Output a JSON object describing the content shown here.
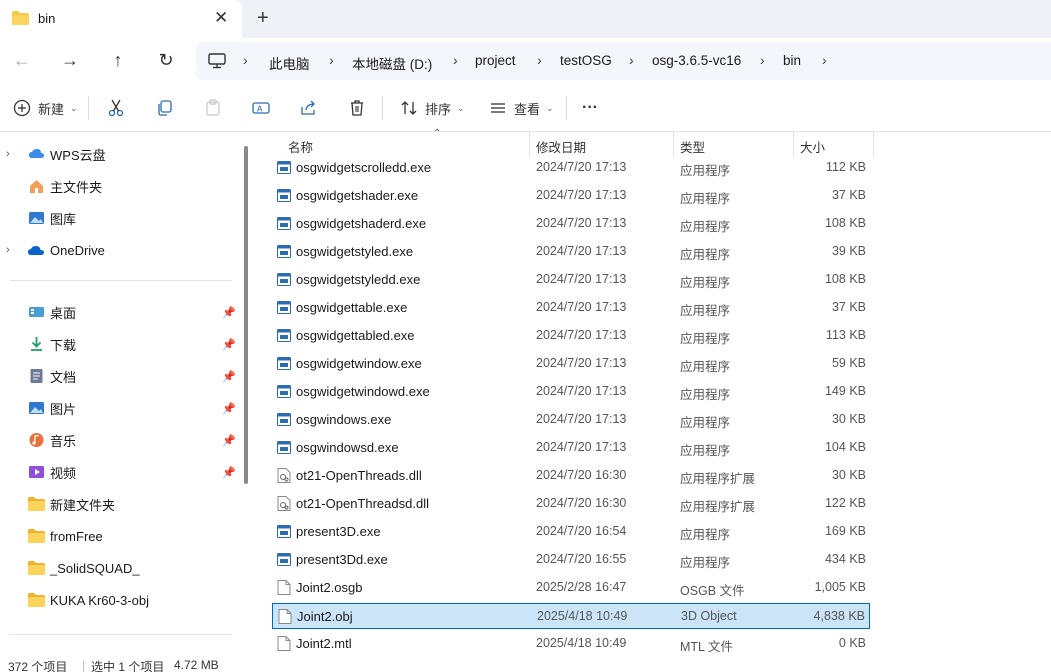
{
  "tab": {
    "title": "bin",
    "close_icon": "close-icon",
    "new_tab": "+"
  },
  "breadcrumbs": [
    "此电脑",
    "本地磁盘 (D:)",
    "project",
    "testOSG",
    "osg-3.6.5-vc16",
    "bin"
  ],
  "toolbar": {
    "new_label": "新建",
    "sort_label": "排序",
    "view_label": "查看",
    "more_label": "···"
  },
  "sidebar": {
    "top": [
      {
        "label": "WPS云盘",
        "icon": "cloud-icon",
        "expandable": true
      },
      {
        "label": "主文件夹",
        "icon": "home-icon",
        "expandable": false
      },
      {
        "label": "图库",
        "icon": "gallery-icon",
        "expandable": false
      },
      {
        "label": "OneDrive",
        "icon": "onedrive-icon",
        "expandable": true
      }
    ],
    "quick": [
      {
        "label": "桌面",
        "icon": "desktop-icon",
        "pinned": true
      },
      {
        "label": "下载",
        "icon": "download-icon",
        "pinned": true
      },
      {
        "label": "文档",
        "icon": "documents-icon",
        "pinned": true
      },
      {
        "label": "图片",
        "icon": "pictures-icon",
        "pinned": true
      },
      {
        "label": "音乐",
        "icon": "music-icon",
        "pinned": true
      },
      {
        "label": "视频",
        "icon": "videos-icon",
        "pinned": true
      },
      {
        "label": "新建文件夹",
        "icon": "folder-icon",
        "pinned": false
      },
      {
        "label": "fromFree",
        "icon": "folder-icon",
        "pinned": false
      },
      {
        "label": "_SolidSQUAD_",
        "icon": "folder-icon",
        "pinned": false
      },
      {
        "label": "KUKA Kr60-3-obj",
        "icon": "folder-icon",
        "pinned": false
      }
    ]
  },
  "columns": {
    "name": "名称",
    "date": "修改日期",
    "type": "类型",
    "size": "大小"
  },
  "files": [
    {
      "name": "osgwidgetscrolledd.exe",
      "date": "2024/7/20 17:13",
      "type": "应用程序",
      "size": "112 KB",
      "kind": "exe"
    },
    {
      "name": "osgwidgetshader.exe",
      "date": "2024/7/20 17:13",
      "type": "应用程序",
      "size": "37 KB",
      "kind": "exe"
    },
    {
      "name": "osgwidgetshaderd.exe",
      "date": "2024/7/20 17:13",
      "type": "应用程序",
      "size": "108 KB",
      "kind": "exe"
    },
    {
      "name": "osgwidgetstyled.exe",
      "date": "2024/7/20 17:13",
      "type": "应用程序",
      "size": "39 KB",
      "kind": "exe"
    },
    {
      "name": "osgwidgetstyledd.exe",
      "date": "2024/7/20 17:13",
      "type": "应用程序",
      "size": "108 KB",
      "kind": "exe"
    },
    {
      "name": "osgwidgettable.exe",
      "date": "2024/7/20 17:13",
      "type": "应用程序",
      "size": "37 KB",
      "kind": "exe"
    },
    {
      "name": "osgwidgettabled.exe",
      "date": "2024/7/20 17:13",
      "type": "应用程序",
      "size": "113 KB",
      "kind": "exe"
    },
    {
      "name": "osgwidgetwindow.exe",
      "date": "2024/7/20 17:13",
      "type": "应用程序",
      "size": "59 KB",
      "kind": "exe"
    },
    {
      "name": "osgwidgetwindowd.exe",
      "date": "2024/7/20 17:13",
      "type": "应用程序",
      "size": "149 KB",
      "kind": "exe"
    },
    {
      "name": "osgwindows.exe",
      "date": "2024/7/20 17:13",
      "type": "应用程序",
      "size": "30 KB",
      "kind": "exe"
    },
    {
      "name": "osgwindowsd.exe",
      "date": "2024/7/20 17:13",
      "type": "应用程序",
      "size": "104 KB",
      "kind": "exe"
    },
    {
      "name": "ot21-OpenThreads.dll",
      "date": "2024/7/20 16:30",
      "type": "应用程序扩展",
      "size": "30 KB",
      "kind": "dll"
    },
    {
      "name": "ot21-OpenThreadsd.dll",
      "date": "2024/7/20 16:30",
      "type": "应用程序扩展",
      "size": "122 KB",
      "kind": "dll"
    },
    {
      "name": "present3D.exe",
      "date": "2024/7/20 16:54",
      "type": "应用程序",
      "size": "169 KB",
      "kind": "exe"
    },
    {
      "name": "present3Dd.exe",
      "date": "2024/7/20 16:55",
      "type": "应用程序",
      "size": "434 KB",
      "kind": "exe"
    },
    {
      "name": "Joint2.osgb",
      "date": "2025/2/28 16:47",
      "type": "OSGB 文件",
      "size": "1,005 KB",
      "kind": "file"
    },
    {
      "name": "Joint2.obj",
      "date": "2025/4/18 10:49",
      "type": "3D Object",
      "size": "4,838 KB",
      "kind": "file",
      "selected": true
    },
    {
      "name": "Joint2.mtl",
      "date": "2025/4/18 10:49",
      "type": "MTL 文件",
      "size": "0 KB",
      "kind": "file"
    }
  ],
  "status": {
    "count": "372 个项目",
    "selection": "选中 1 个项目",
    "selection_size": "4.72 MB"
  },
  "colors": {
    "accent": "#0067c0",
    "selected_bg": "#cce4f7",
    "folder_yellow": "#f7c948"
  }
}
